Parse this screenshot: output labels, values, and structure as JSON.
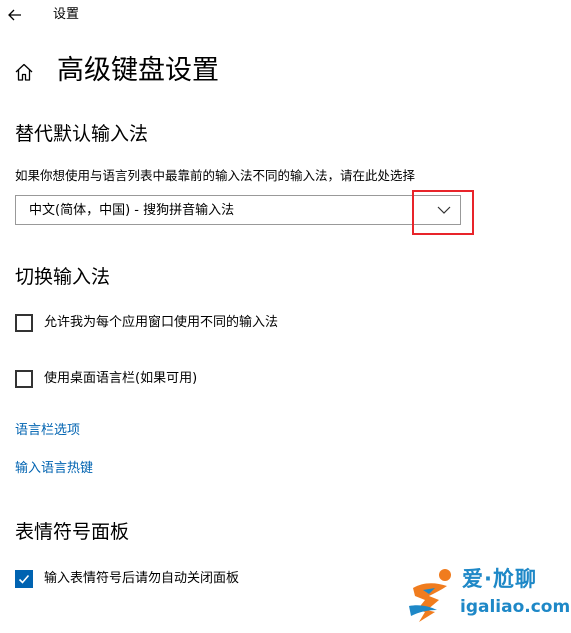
{
  "header": {
    "app_title": "设置",
    "page_title": "高级键盘设置"
  },
  "override_section": {
    "heading": "替代默认输入法",
    "description": "如果你想使用与语言列表中最靠前的输入法不同的输入法，请在此处选择",
    "dropdown_value": "中文(简体，中国) - 搜狗拼音输入法"
  },
  "switch_section": {
    "heading": "切换输入法",
    "checkbox_per_app": {
      "label": "允许我为每个应用窗口使用不同的输入法",
      "checked": false
    },
    "checkbox_language_bar": {
      "label": "使用桌面语言栏(如果可用)",
      "checked": false
    },
    "link_language_bar_options": "语言栏选项",
    "link_input_hotkeys": "输入语言热键"
  },
  "emoji_section": {
    "heading": "表情符号面板",
    "checkbox_auto_close": {
      "label": "输入表情符号后请勿自动关闭面板",
      "checked": true
    }
  },
  "watermark": {
    "top_text": "爱·尬聊",
    "bottom_text": "igaliao.com"
  },
  "colors": {
    "accent": "#0063b1",
    "highlight_box": "#e8242a",
    "watermark": "#1e88c7"
  }
}
